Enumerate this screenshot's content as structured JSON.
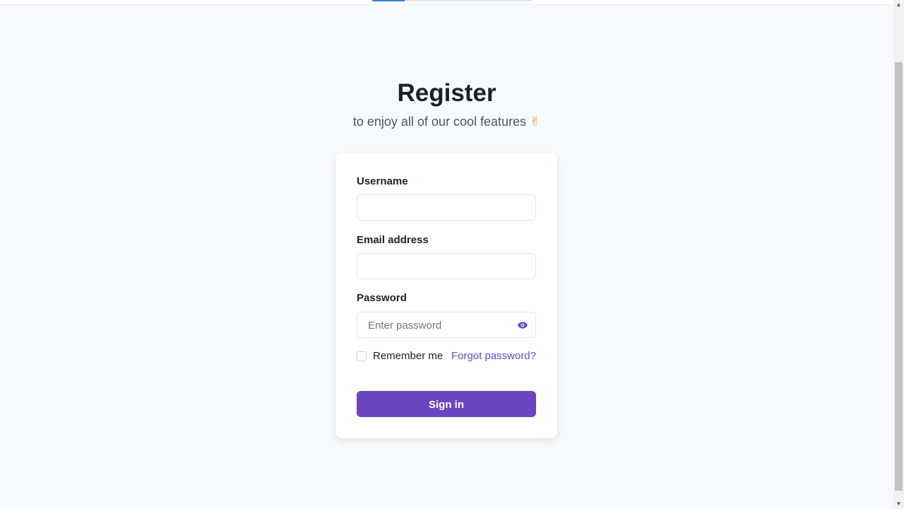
{
  "header": {
    "title": "Register",
    "subtitle": "to enjoy all of our cool features",
    "subtitle_emoji": "✌"
  },
  "form": {
    "username": {
      "label": "Username",
      "value": "",
      "placeholder": ""
    },
    "email": {
      "label": "Email address",
      "value": "",
      "placeholder": ""
    },
    "password": {
      "label": "Password",
      "value": "",
      "placeholder": "Enter password",
      "toggle_icon": "eye-icon"
    },
    "remember_label": "Remember me",
    "remember_checked": false,
    "forgot_label": "Forgot password?",
    "submit_label": "Sign in"
  },
  "colors": {
    "accent": "#6b46c1",
    "background": "#f7fafc",
    "card": "#ffffff",
    "heading": "#1a202c",
    "muted": "#4a5568"
  }
}
